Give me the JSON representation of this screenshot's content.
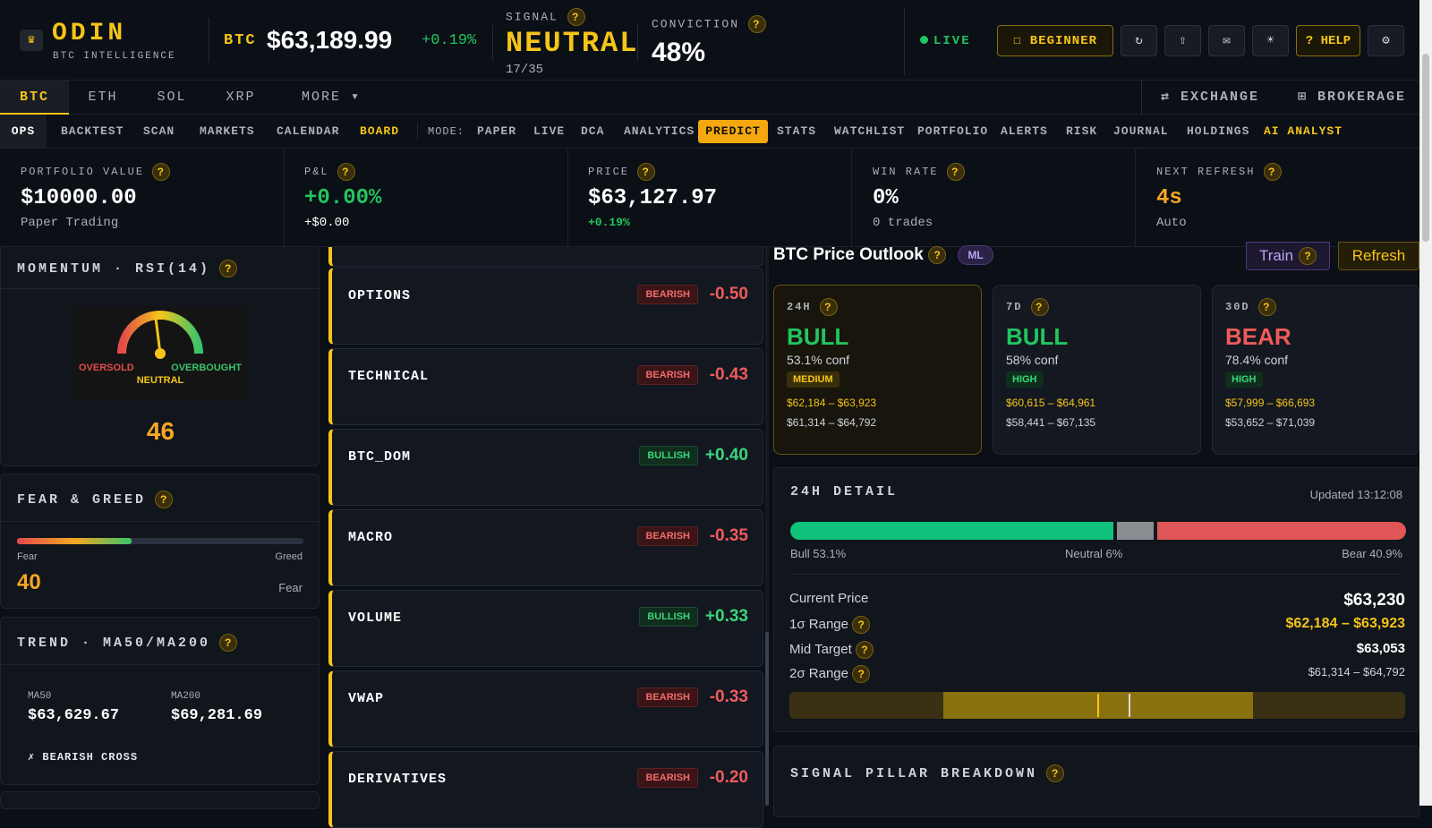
{
  "brand": {
    "title": "ODIN",
    "subtitle": "BTC INTELLIGENCE",
    "logo_icon": "crown-icon"
  },
  "ticker": {
    "symbol": "BTC",
    "price": "$63,189.99",
    "change": "+0.19%"
  },
  "signal": {
    "label": "SIGNAL",
    "value": "NEUTRAL",
    "count": "17/35"
  },
  "conviction": {
    "label": "CONVICTION",
    "value": "48%"
  },
  "live": "LIVE",
  "toolbar": {
    "beginner": "☐ BEGINNER",
    "refresh": "↻",
    "share": "⇧",
    "mail": "✉",
    "theme": "☀",
    "help": "? HELP",
    "settings": "⚙"
  },
  "assets": [
    "BTC",
    "ETH",
    "SOL",
    "XRP",
    "MORE ▾"
  ],
  "exchange": "⇄ EXCHANGE",
  "brokerage": "⊞ BROKERAGE",
  "nav": {
    "ops": "OPS",
    "backtest": "BACKTEST",
    "scan": "SCAN",
    "markets": "MARKETS",
    "calendar": "CALENDAR",
    "board": "BOARD",
    "mode": "MODE:",
    "paper": "PAPER",
    "live": "LIVE",
    "dca": "DCA",
    "analytics": "ANALYTICS",
    "predict": "PREDICT",
    "stats": "STATS",
    "watchlist": "WATCHLIST",
    "portfolio": "PORTFOLIO",
    "alerts": "ALERTS",
    "risk": "RISK",
    "journal": "JOURNAL",
    "holdings": "HOLDINGS",
    "ai": "AI ANALYST"
  },
  "stats": [
    {
      "label": "PORTFOLIO VALUE",
      "value": "$10000.00",
      "sub": "Paper Trading",
      "color": "#ffffff"
    },
    {
      "label": "P&L",
      "value": "+0.00%",
      "sub": "+$0.00",
      "color": "#22c55e"
    },
    {
      "label": "PRICE",
      "value": "$63,127.97",
      "sub": "+0.19%",
      "color": "#ffffff"
    },
    {
      "label": "WIN RATE",
      "value": "0%",
      "sub": "0 trades",
      "color": "#ffffff"
    },
    {
      "label": "NEXT REFRESH",
      "value": "4s",
      "sub": "Auto",
      "color": "#f5a623"
    }
  ],
  "momentum": {
    "title": "MOMENTUM · RSI(14)",
    "oversold": "OVERSOLD",
    "overbought": "OVERBOUGHT",
    "neutral": "NEUTRAL",
    "value": "46",
    "rsi": 46
  },
  "fear_greed": {
    "title": "FEAR & GREED",
    "left": "Fear",
    "right": "Greed",
    "value": "40",
    "label": "Fear",
    "level": 0.4
  },
  "trend": {
    "title": "TREND · MA50/MA200",
    "ma50_label": "MA50",
    "ma50": "$63,629.67",
    "ma200_label": "MA200",
    "ma200": "$69,281.69",
    "cross": "✗ BEARISH CROSS"
  },
  "signals": [
    {
      "name": "OPTIONS",
      "sentiment": "BEARISH",
      "score": "-0.50"
    },
    {
      "name": "TECHNICAL",
      "sentiment": "BEARISH",
      "score": "-0.43"
    },
    {
      "name": "BTC_DOM",
      "sentiment": "BULLISH",
      "score": "+0.40"
    },
    {
      "name": "MACRO",
      "sentiment": "BEARISH",
      "score": "-0.35"
    },
    {
      "name": "VOLUME",
      "sentiment": "BULLISH",
      "score": "+0.33"
    },
    {
      "name": "VWAP",
      "sentiment": "BEARISH",
      "score": "-0.33"
    },
    {
      "name": "DERIVATIVES",
      "sentiment": "BEARISH",
      "score": "-0.20"
    }
  ],
  "outlook": {
    "title": "BTC Price Outlook",
    "ml": "ML",
    "train": "Train",
    "refresh": "Refresh",
    "cards": [
      {
        "h": "24H",
        "dir": "BULL",
        "conf": "53.1% conf",
        "tag": "MEDIUM",
        "r1": "$62,184 – $63,923",
        "r2": "$61,314 – $64,792"
      },
      {
        "h": "7D",
        "dir": "BULL",
        "conf": "58% conf",
        "tag": "HIGH",
        "r1": "$60,615 – $64,961",
        "r2": "$58,441 – $67,135"
      },
      {
        "h": "30D",
        "dir": "BEAR",
        "conf": "78.4% conf",
        "tag": "HIGH",
        "r1": "$57,999 – $66,693",
        "r2": "$53,652 – $71,039"
      }
    ]
  },
  "detail": {
    "title": "24H DETAIL",
    "updated": "Updated 13:12:08",
    "bull": "Bull 53.1%",
    "neutral": "Neutral 6%",
    "bear": "Bear 40.9%",
    "bull_pct": 53.1,
    "neutral_pct": 6,
    "bear_pct": 40.9,
    "current_label": "Current Price",
    "current": "$63,230",
    "r1_label": "1σ Range",
    "r1": "$62,184 – $63,923",
    "mid_label": "Mid Target",
    "mid": "$63,053",
    "r2_label": "2σ Range",
    "r2": "$61,314 – $64,792"
  },
  "pillars": {
    "title": "SIGNAL PILLAR BREAKDOWN"
  }
}
